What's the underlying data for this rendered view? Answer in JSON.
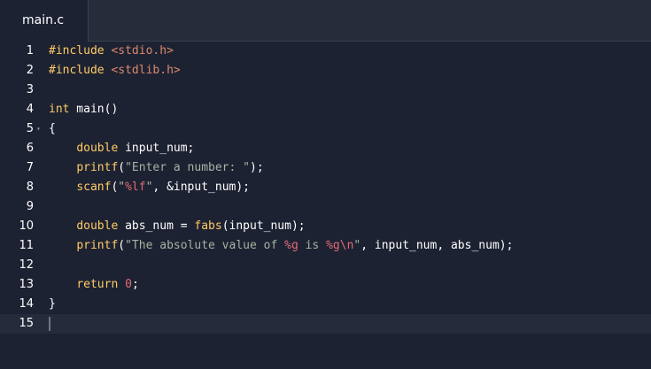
{
  "tab": {
    "label": "main.c"
  },
  "editor": {
    "active_line": 15,
    "lines": [
      {
        "num": "1",
        "tokens": [
          {
            "t": "#include ",
            "c": "pp"
          },
          {
            "t": "<stdio.h>",
            "c": "inc"
          }
        ]
      },
      {
        "num": "2",
        "tokens": [
          {
            "t": "#include ",
            "c": "pp"
          },
          {
            "t": "<stdlib.h>",
            "c": "inc"
          }
        ]
      },
      {
        "num": "3",
        "tokens": []
      },
      {
        "num": "4",
        "tokens": [
          {
            "t": "int",
            "c": "kw"
          },
          {
            "t": " main()",
            "c": "txt"
          }
        ]
      },
      {
        "num": "5",
        "fold": "▾",
        "tokens": [
          {
            "t": "{",
            "c": "txt"
          }
        ]
      },
      {
        "num": "6",
        "tokens": [
          {
            "t": "    ",
            "c": "txt"
          },
          {
            "t": "double",
            "c": "kw"
          },
          {
            "t": " input_num;",
            "c": "txt"
          }
        ]
      },
      {
        "num": "7",
        "tokens": [
          {
            "t": "    ",
            "c": "txt"
          },
          {
            "t": "printf",
            "c": "kw"
          },
          {
            "t": "(",
            "c": "txt"
          },
          {
            "t": "\"Enter a number: \"",
            "c": "str"
          },
          {
            "t": ");",
            "c": "txt"
          }
        ]
      },
      {
        "num": "8",
        "tokens": [
          {
            "t": "    ",
            "c": "txt"
          },
          {
            "t": "scanf",
            "c": "kw"
          },
          {
            "t": "(",
            "c": "txt"
          },
          {
            "t": "\"",
            "c": "str"
          },
          {
            "t": "%lf",
            "c": "fmt"
          },
          {
            "t": "\"",
            "c": "str"
          },
          {
            "t": ", &input_num);",
            "c": "txt"
          }
        ]
      },
      {
        "num": "9",
        "tokens": []
      },
      {
        "num": "10",
        "tokens": [
          {
            "t": "    ",
            "c": "txt"
          },
          {
            "t": "double",
            "c": "kw"
          },
          {
            "t": " abs_num = ",
            "c": "txt"
          },
          {
            "t": "fabs",
            "c": "kw"
          },
          {
            "t": "(input_num);",
            "c": "txt"
          }
        ]
      },
      {
        "num": "11",
        "tokens": [
          {
            "t": "    ",
            "c": "txt"
          },
          {
            "t": "printf",
            "c": "kw"
          },
          {
            "t": "(",
            "c": "txt"
          },
          {
            "t": "\"The absolute value of ",
            "c": "str"
          },
          {
            "t": "%g",
            "c": "fmt"
          },
          {
            "t": " is ",
            "c": "str"
          },
          {
            "t": "%g\\n",
            "c": "fmt"
          },
          {
            "t": "\"",
            "c": "str"
          },
          {
            "t": ", input_num, abs_num);",
            "c": "txt"
          }
        ]
      },
      {
        "num": "12",
        "tokens": []
      },
      {
        "num": "13",
        "tokens": [
          {
            "t": "    ",
            "c": "txt"
          },
          {
            "t": "return",
            "c": "kw"
          },
          {
            "t": " ",
            "c": "txt"
          },
          {
            "t": "0",
            "c": "num"
          },
          {
            "t": ";",
            "c": "txt"
          }
        ]
      },
      {
        "num": "14",
        "tokens": [
          {
            "t": "}",
            "c": "txt"
          }
        ]
      },
      {
        "num": "15",
        "tokens": []
      }
    ]
  }
}
